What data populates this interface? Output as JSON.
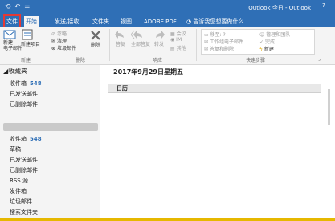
{
  "window": {
    "title": "Outlook 今日 - Outlook",
    "question_icon": "?"
  },
  "tabs": [
    {
      "label": "文件"
    },
    {
      "label": "开始"
    },
    {
      "label": "发送/接收"
    },
    {
      "label": "文件夹"
    },
    {
      "label": "视图"
    },
    {
      "label": "ADOBE PDF"
    }
  ],
  "tell_me": "告诉我您想要做什么...",
  "ribbon": {
    "new": {
      "new_email": "新建\n电子邮件",
      "new_items": "新建项目",
      "group": "新建"
    },
    "delete": {
      "ignore": "忽略",
      "cleanup": "清理",
      "junk": "垃圾邮件",
      "delete": "删除",
      "group": "删除"
    },
    "respond": {
      "reply": "答复",
      "reply_all": "全部答复",
      "forward": "转发",
      "meeting": "会议",
      "im": "IM",
      "more": "其他",
      "group": "响应"
    },
    "quicksteps": {
      "move_to": "移至: ?",
      "manager": "管理和团队",
      "team_email": "工作组电子邮件",
      "reply_delete": "答复和删除",
      "done": "完成",
      "create_new": "新建",
      "group": "快速步骤"
    }
  },
  "nav": {
    "favorites": "收藏夹",
    "fav_items": [
      {
        "label": "收件箱",
        "count": "548"
      },
      {
        "label": "已发送邮件"
      },
      {
        "label": "已删除邮件"
      }
    ],
    "account_items": [
      {
        "label": "收件箱",
        "count": "548"
      },
      {
        "label": "草稿"
      },
      {
        "label": "已发送邮件"
      },
      {
        "label": "已删除邮件"
      },
      {
        "label": "RSS 源"
      },
      {
        "label": "发件箱"
      },
      {
        "label": "垃圾邮件"
      },
      {
        "label": "搜索文件夹"
      }
    ]
  },
  "main": {
    "date": "2017年9月29日星期五",
    "calendar_header": "日历"
  },
  "colors": {
    "brand": "#2f6fb6",
    "file_highlight": "#e53935",
    "count": "#2f6fb6"
  }
}
